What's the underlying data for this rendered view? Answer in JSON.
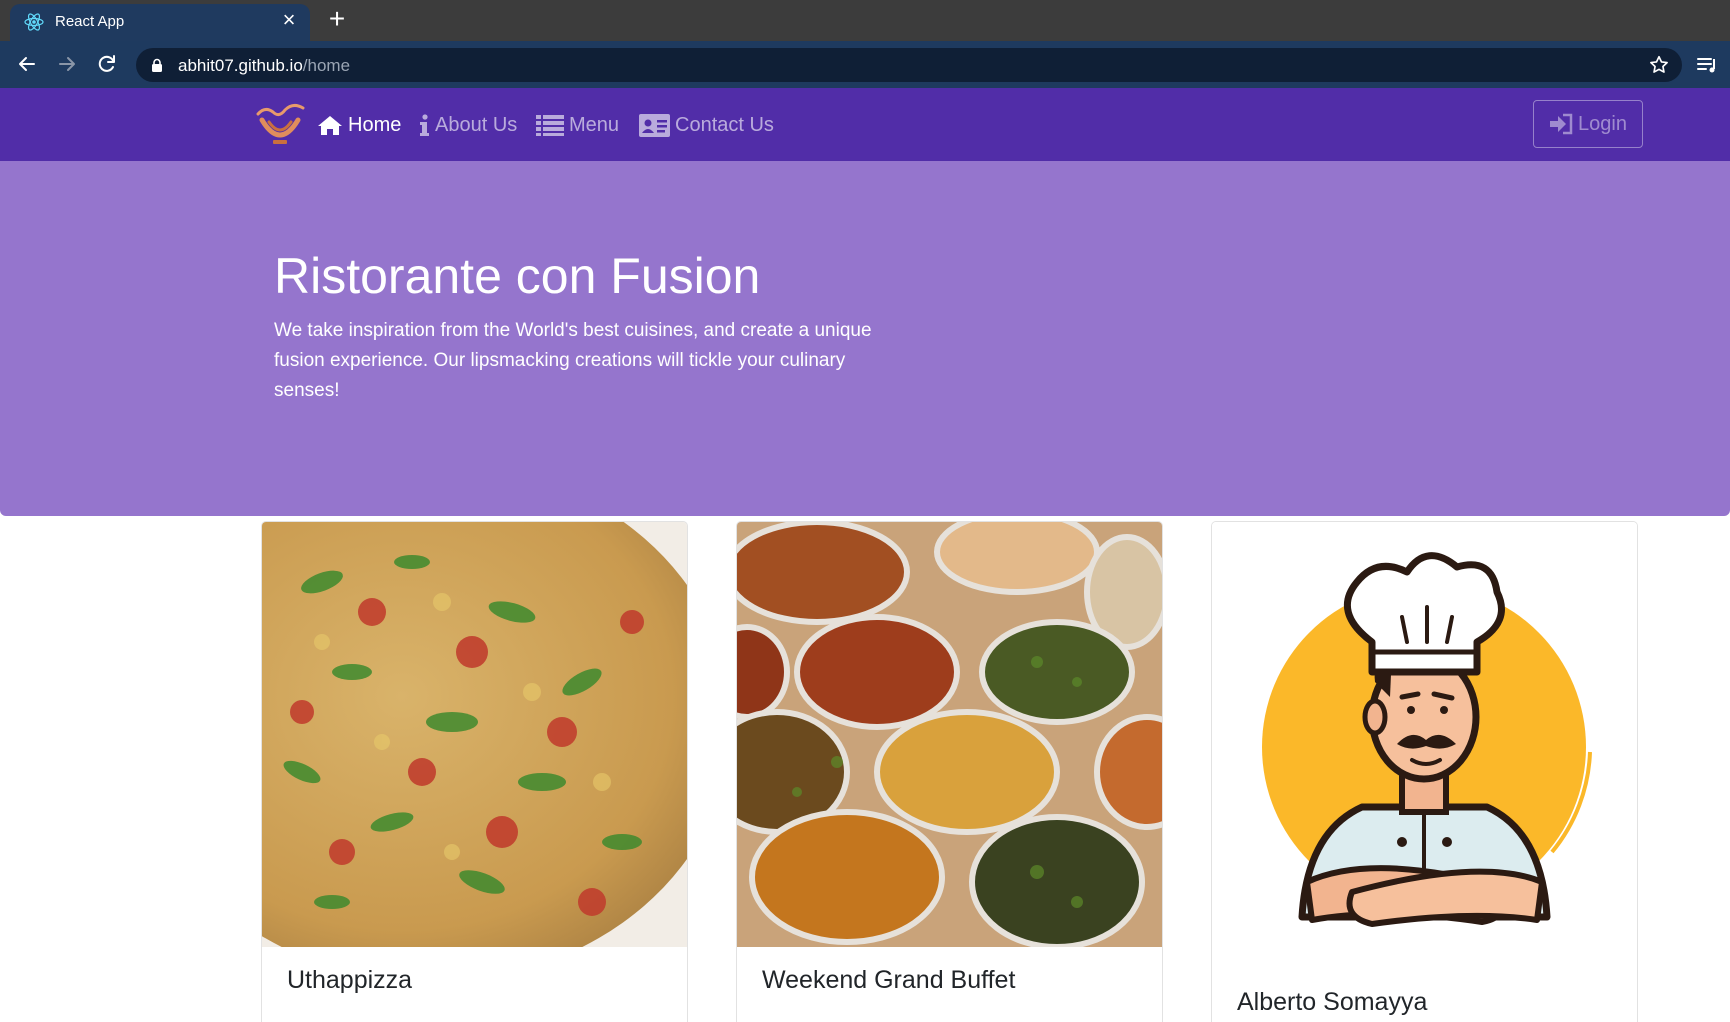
{
  "browser": {
    "tab_title": "React App",
    "tab_favicon_icon": "react-atom-icon",
    "url_host": "abhit07.github.io",
    "url_path": "/home"
  },
  "navbar": {
    "items": [
      {
        "label": "Home",
        "icon": "home-icon",
        "active": true
      },
      {
        "label": "About Us",
        "icon": "info-icon",
        "active": false
      },
      {
        "label": "Menu",
        "icon": "list-icon",
        "active": false
      },
      {
        "label": "Contact Us",
        "icon": "address-card-icon",
        "active": false
      }
    ],
    "login_label": "Login",
    "login_icon": "sign-in-icon"
  },
  "jumbotron": {
    "title": "Ristorante con Fusion",
    "text": "We take inspiration from the World's best cuisines, and create a unique fusion experience. Our lipsmacking creations will tickle your culinary senses!"
  },
  "cards": [
    {
      "title": "Uthappizza",
      "image": "pizza-photo"
    },
    {
      "title": "Weekend Grand Buffet",
      "image": "buffet-photo"
    },
    {
      "title": "Alberto Somayya",
      "image": "chef-illustration"
    }
  ],
  "colors": {
    "navbar": "#512da8",
    "jumbotron": "#9575cd",
    "chrome_toolbar": "#1e3a5f",
    "chrome_tabstrip": "#3c3c3c"
  }
}
